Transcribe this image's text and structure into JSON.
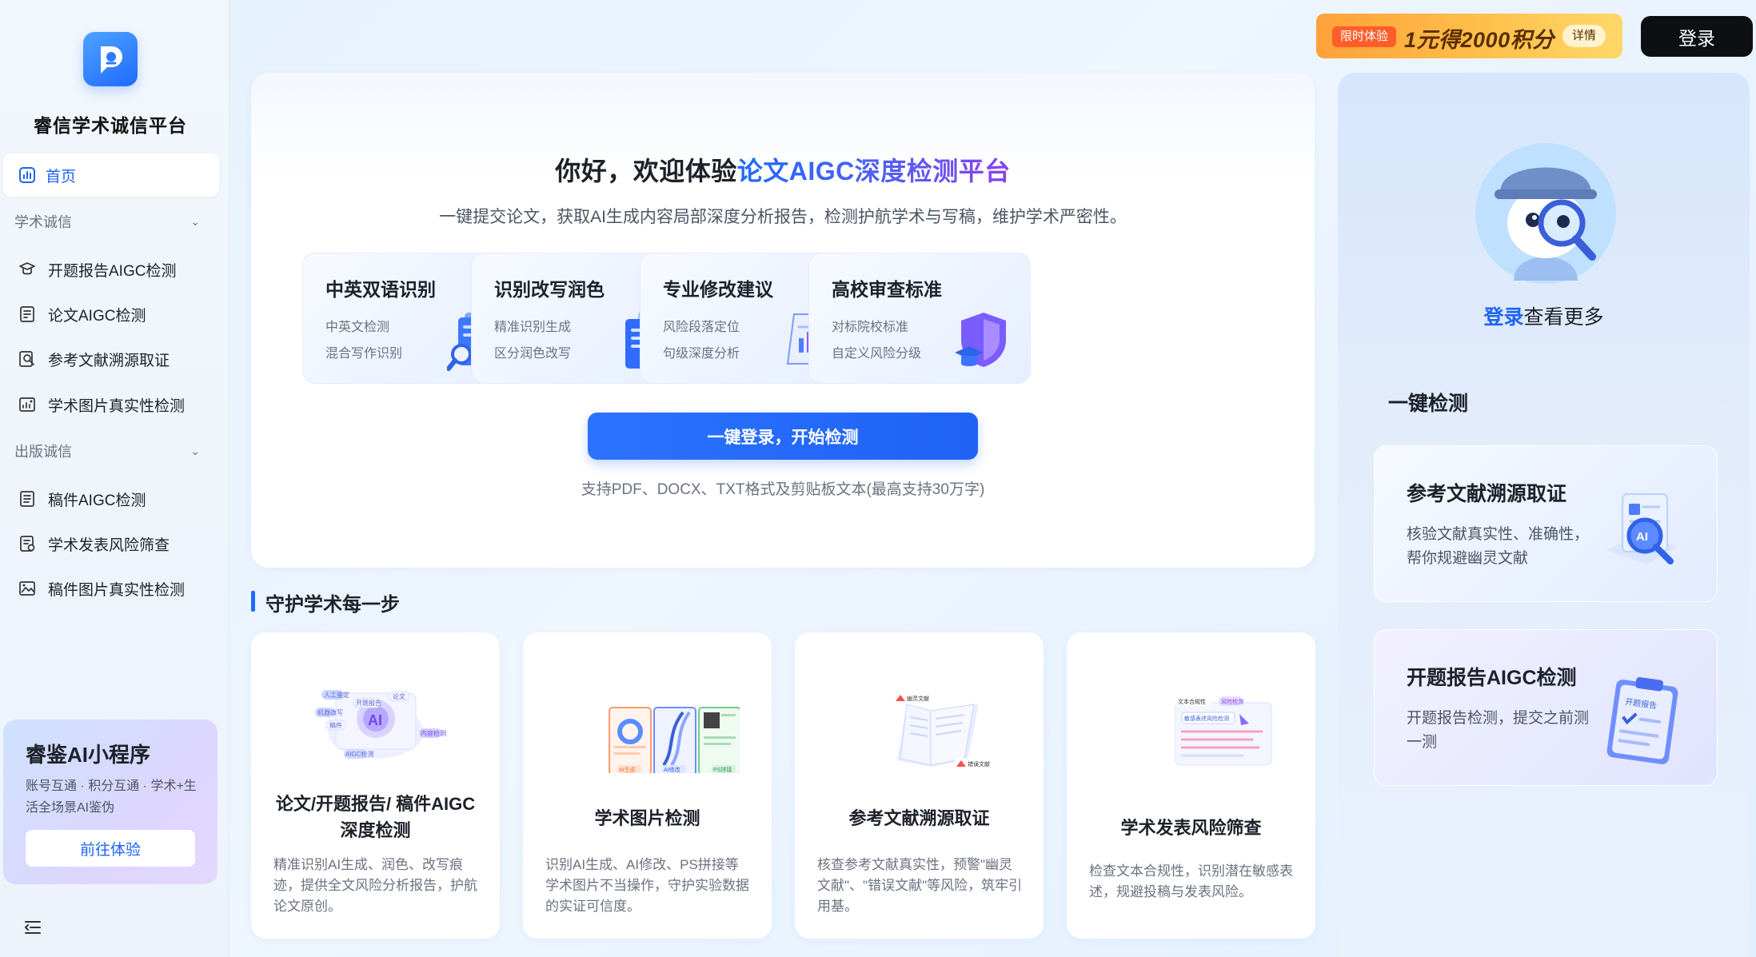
{
  "brand": {
    "name": "睿信学术诚信平台",
    "accent": "#1f6bff"
  },
  "sidebar": {
    "home": "首页",
    "groups": [
      {
        "label": "学术诚信",
        "items": [
          "开题报告AIGC检测",
          "论文AIGC检测",
          "参考文献溯源取证",
          "学术图片真实性检测"
        ]
      },
      {
        "label": "出版诚信",
        "items": [
          "稿件AIGC检测",
          "学术发表风险筛查",
          "稿件图片真实性检测"
        ]
      }
    ],
    "mini_program": {
      "title": "睿鉴AI小程序",
      "desc": "账号互通 · 积分互通 · 学术+生活全场景AI鉴伪",
      "button": "前往体验"
    }
  },
  "topbar": {
    "promo_tag": "限时体验",
    "promo_text": "1元得2000积分",
    "promo_detail": "详情",
    "login": "登录"
  },
  "hero": {
    "title_prefix": "你好，欢迎体验",
    "title_highlight": "论文AIGC深度检测平台",
    "subtitle": "一键提交论文，获取AI生成内容局部深度分析报告，检测护航学术与写稿，维护学术严密性。",
    "features": [
      {
        "title": "中英双语识别",
        "line1": "中英文检测",
        "line2": "混合写作识别",
        "icon": "book-search-icon"
      },
      {
        "title": "识别改写润色",
        "line1": "精准识别生成",
        "line2": "区分润色改写",
        "icon": "documents-icon"
      },
      {
        "title": "专业修改建议",
        "line1": "风险段落定位",
        "line2": "句级深度分析",
        "icon": "report-chart-icon"
      },
      {
        "title": "高校审查标准",
        "line1": "对标院校标准",
        "line2": "自定义风险分级",
        "icon": "graduation-shield-icon"
      }
    ],
    "cta": "一键登录，开始检测",
    "note": "支持PDF、DOCX、TXT格式及剪贴板文本(最高支持30万字)"
  },
  "section": {
    "title": "守护学术每一步",
    "cards": [
      {
        "title": "论文/开题报告/ 稿件AIGC深度检测",
        "desc": "精准识别AI生成、润色、改写痕迹，提供全文风险分析报告，护航论文原创。",
        "illus": {
          "chips": [
            "论文",
            "开题报告",
            "稿件",
            "AI",
            "内容检测",
            "人工鉴定",
            "机器改写",
            "AIGC检测"
          ]
        }
      },
      {
        "title": "学术图片检测",
        "desc": "识别AI生成、AI修改、PS拼接等学术图片不当操作，守护实验数据的实证可信度。",
        "illus": {
          "labels": [
            "AI生成",
            "AI修改",
            "PS拼接"
          ]
        }
      },
      {
        "title": "参考文献溯源取证",
        "desc": "核查参考文献真实性，预警\"幽灵文献\"、\"错误文献\"等风险，筑牢引用基。",
        "illus": {
          "labels": [
            "幽灵文献",
            "错误文献"
          ]
        }
      },
      {
        "title": "学术发表风险筛查",
        "desc": "检查文本合规性，识别潜在敏感表述，规避投稿与发表风险。",
        "illus": {
          "labels": [
            "文本合规性",
            "风险检测",
            "敏感表述风险检测"
          ]
        }
      }
    ]
  },
  "right_panel": {
    "login_link": "登录",
    "login_rest": "查看更多",
    "section": "一键检测",
    "cards": [
      {
        "title": "参考文献溯源取证",
        "desc": "核验文献真实性、准确性，帮你规避幽灵文献",
        "icon": "ai-magnifier-doc-icon"
      },
      {
        "title": "开题报告AIGC检测",
        "desc": "开题报告检测，提交之前测一测",
        "icon": "clipboard-report-icon",
        "badge": "开题报告"
      }
    ]
  }
}
